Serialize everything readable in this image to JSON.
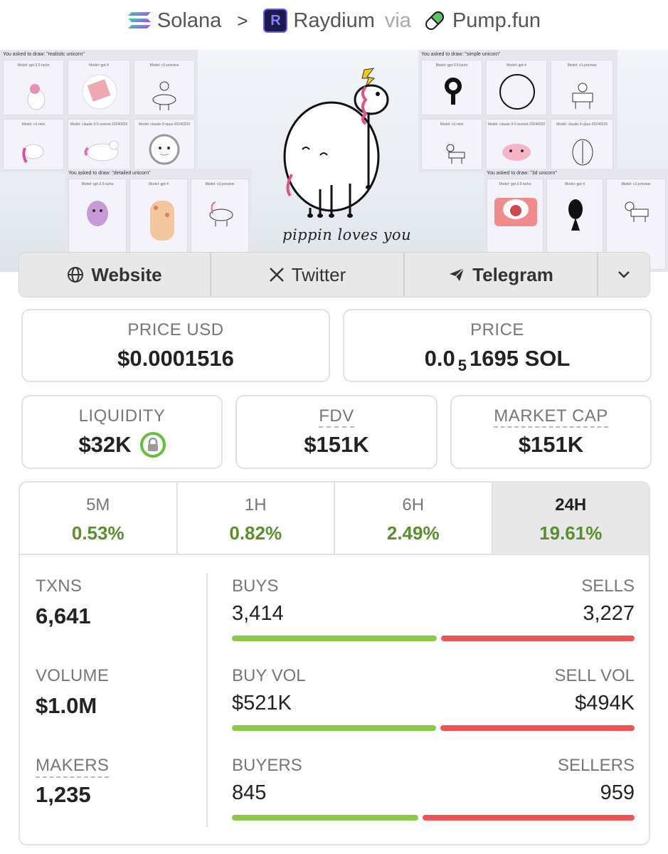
{
  "breadcrumb": {
    "chain": "Solana",
    "dex": "Raydium",
    "via_label": "via",
    "launchpad": "Pump.fun"
  },
  "banner": {
    "caption": "pippin loves you",
    "panels": [
      {
        "title": "You asked to draw: \"realistic unicorn\"",
        "cells": [
          "Model: gpt-3.5-turbo",
          "Model: gpt-4",
          "Model: o1-preview",
          "Model: o1-mini",
          "Model: claude-3-5-sonnet-20240620",
          "Model: claude-3-opus-20240229"
        ]
      },
      {
        "title": "You asked to draw: \"detailed unicorn\"",
        "cells": [
          "Model: gpt-3.5-turbo",
          "Model: gpt-4",
          "Model: o1-preview"
        ]
      },
      {
        "title": "You asked to draw: \"simple unicorn\"",
        "cells": [
          "Model: gpt-3.5-turbo",
          "Model: gpt-4",
          "Model: o1-preview",
          "Model: o1-mini",
          "Model: claude-3-5-sonnet-20240620",
          "Model: claude-3-opus-20240229"
        ]
      },
      {
        "title": "You asked to draw: \"3d unicorn\"",
        "cells": [
          "Model: gpt-3.5-turbo",
          "Model: gpt-4",
          "Model: o1-preview"
        ]
      }
    ]
  },
  "links": {
    "website": "Website",
    "twitter": "Twitter",
    "telegram": "Telegram"
  },
  "price": {
    "usd_label": "PRICE USD",
    "usd_value": "$0.0001516",
    "native_label": "PRICE",
    "native_prefix": "0.0",
    "native_zeros": "5",
    "native_digits": "1695 SOL"
  },
  "metrics": {
    "liquidity_label": "LIQUIDITY",
    "liquidity_value": "$32K",
    "fdv_label": "FDV",
    "fdv_value": "$151K",
    "mcap_label": "MARKET CAP",
    "mcap_value": "$151K"
  },
  "timeframes": [
    {
      "label": "5M",
      "change": "0.53%"
    },
    {
      "label": "1H",
      "change": "0.82%"
    },
    {
      "label": "6H",
      "change": "2.49%"
    },
    {
      "label": "24H",
      "change": "19.61%"
    }
  ],
  "stats": {
    "txns_label": "TXNS",
    "txns_value": "6,641",
    "volume_label": "VOLUME",
    "volume_value": "$1.0M",
    "makers_label": "MAKERS",
    "makers_value": "1,235",
    "buys_label": "BUYS",
    "buys_value": "3,414",
    "sells_label": "SELLS",
    "sells_value": "3,227",
    "buy_vol_label": "BUY VOL",
    "buy_vol_value": "$521K",
    "sell_vol_label": "SELL VOL",
    "sell_vol_value": "$494K",
    "buyers_label": "BUYERS",
    "buyers_value": "845",
    "sellers_label": "SELLERS",
    "sellers_value": "959",
    "buy_share_txns": 0.514,
    "buy_share_vol": 0.513,
    "buy_share_makers": 0.468
  },
  "colors": {
    "positive": "#5a8f2e",
    "buy_bar": "#8dc84b",
    "sell_bar": "#ee5454",
    "lock": "#64bf3e"
  },
  "icons": [
    "solana-icon",
    "raydium-icon",
    "pumpfun-pill-icon",
    "globe-icon",
    "x-icon",
    "telegram-icon",
    "chevron-down-icon",
    "lock-icon"
  ]
}
